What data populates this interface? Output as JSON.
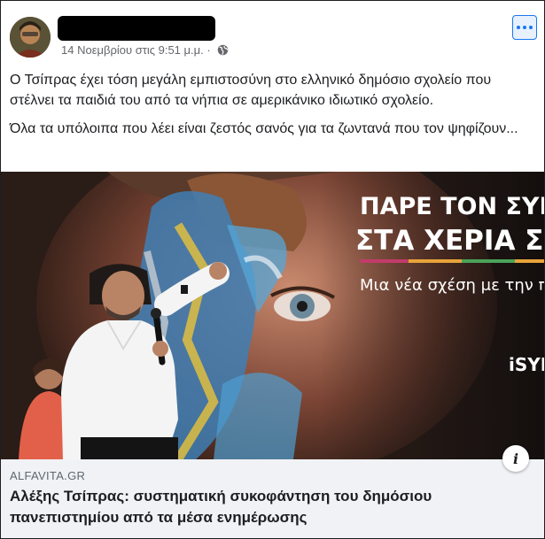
{
  "post": {
    "timestamp": "14 Νοεμβρίου στις 9:51 μ.μ. ·",
    "paragraphs": [
      "Ο Τσίπρας έχει τόση μεγάλη εμπιστοσύνη στο ελληνικό δημόσιο σχολείο που στέλνει τα παιδιά του από τα νήπια σε αμερικάνικο ιδιωτικό σχολείο.",
      "Όλα τα υπόλοιπα που λέει είναι ζεστός σανός για τα ζωντανά που τον ψηφίζουν..."
    ]
  },
  "image": {
    "banner_line1": "ΠΑΡΕ ΤΟΝ ΣΥΡ",
    "banner_line2": "ΣΤΑ ΧΕΡΙΑ Σ",
    "banner_line3": "Μια νέα σχέση με την πο",
    "banner_logo": "iSYI"
  },
  "link": {
    "domain": "ALFAVITA.GR",
    "title": "Αλέξης Τσίπρας: συστηματική συκοφάντηση του δημόσιου πανεπιστημίου από τα μέσα ενημέρωσης",
    "info_label": "i"
  },
  "colors": {
    "accent": "#1877f2",
    "text": "#1c1e21",
    "secondary": "#65676b",
    "link_bg": "#f0f2f5"
  }
}
